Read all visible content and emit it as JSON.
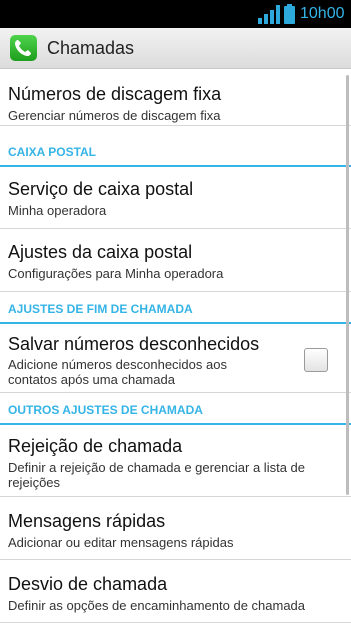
{
  "status_bar": {
    "time": "10h00",
    "signal_icon": "signal-bars-icon",
    "battery_icon": "battery-icon"
  },
  "action_bar": {
    "title": "Chamadas",
    "icon": "phone-icon"
  },
  "settings": {
    "fixed_dialing": {
      "title": "Números de discagem fixa",
      "subtitle": "Gerenciar números de discagem fixa"
    },
    "voicemail_header": "CAIXA POSTAL",
    "voicemail_service": {
      "title": "Serviço de caixa postal",
      "subtitle": "Minha operadora"
    },
    "voicemail_settings": {
      "title": "Ajustes da caixa postal",
      "subtitle": "Configurações  para Minha operadora"
    },
    "end_call_header": "AJUSTES DE FIM DE CHAMADA",
    "save_unknown": {
      "title": "Salvar números desconhecidos",
      "subtitle_line1": "Adicione números desconhecidos aos",
      "subtitle_line2": "contatos após uma chamada",
      "checked": false
    },
    "other_header": "OUTROS AJUSTES DE CHAMADA",
    "call_reject": {
      "title": "Rejeição de chamada",
      "subtitle_line1": "Definir a rejeição de chamada e gerenciar a lista de",
      "subtitle_line2": "rejeições"
    },
    "quick_messages": {
      "title": "Mensagens rápidas",
      "subtitle": "Adicionar ou editar mensagens rápidas"
    },
    "call_forwarding": {
      "title": "Desvio de chamada",
      "subtitle": "Definir as opções de encaminhamento de chamada"
    }
  }
}
